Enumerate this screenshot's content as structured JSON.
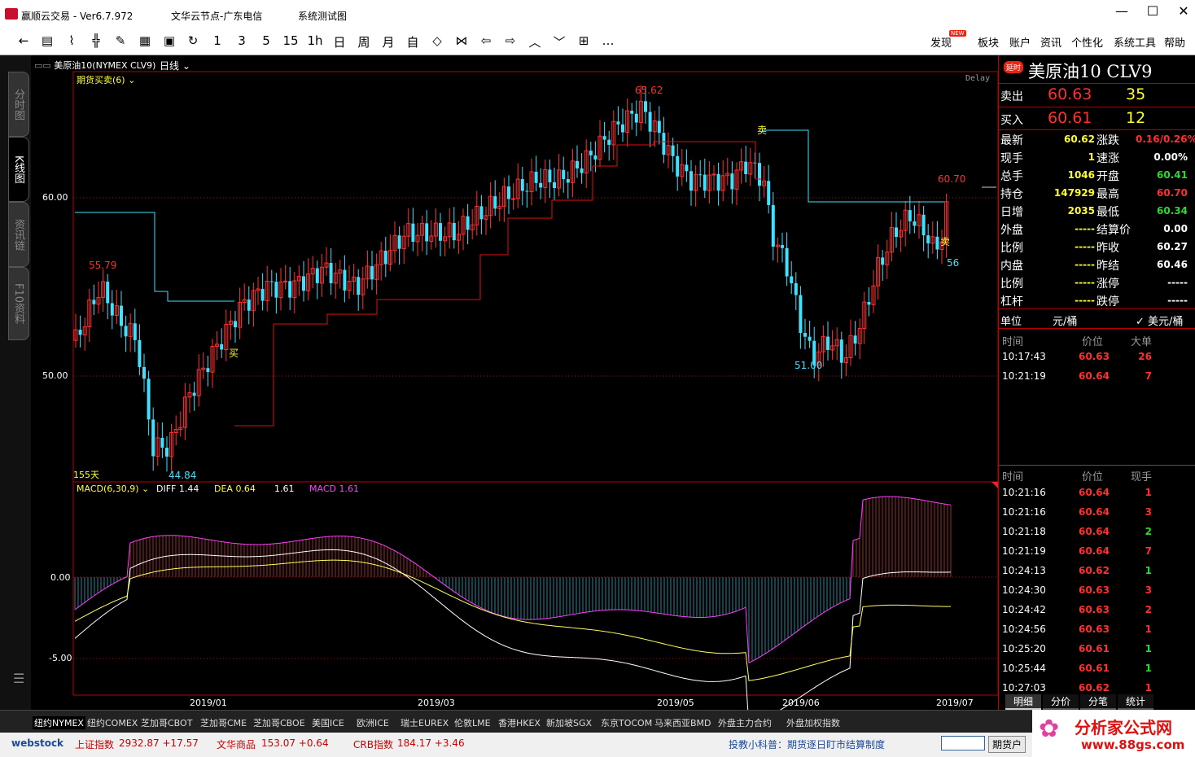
{
  "window": {
    "title": "赢顺云交易 - Ver6.7.972",
    "node": "文华云节点-广东电信",
    "test": "系统测试图"
  },
  "toolbar": {
    "periods": [
      "1",
      "3",
      "5",
      "15",
      "1h",
      "日",
      "周",
      "月",
      "自"
    ],
    "menu": [
      "发现",
      "板块",
      "账户",
      "资讯",
      "个性化",
      "系统工具",
      "帮助"
    ],
    "new_badge": "NEW"
  },
  "left_tabs": [
    "分时图",
    "K线图",
    "资讯链",
    "F10资料"
  ],
  "chart": {
    "header": "美原油10(NYMEX CLV9)",
    "period": "日线",
    "indicator": "期货买卖(6)",
    "delay": "Delay",
    "days": "155天",
    "price_labels": [
      "60.00",
      "50.00"
    ],
    "macd_labels": [
      "0.00",
      "-5.00"
    ],
    "date_labels": [
      "2019/01",
      "2019/03",
      "2019/05",
      "2019/06",
      "2019/07"
    ],
    "annotations": {
      "high": "65.62",
      "low": "44.84",
      "left_high": "55.79",
      "mid_low": "51.00",
      "right_high": "60.70",
      "right_low": "56"
    },
    "signals": {
      "buy": "买",
      "sell": "卖",
      "sell2": "卖"
    },
    "macd": {
      "name": "MACD(6,30,9)",
      "diff": "DIFF 1.44",
      "dea": "DEA 0.64",
      "val": "1.61",
      "macd": "MACD 1.61"
    }
  },
  "right": {
    "badge": "延时",
    "title": "美原油10 CLV9",
    "sell": {
      "label": "卖出",
      "price": "60.63",
      "vol": "35"
    },
    "buy": {
      "label": "买入",
      "price": "60.61",
      "vol": "12"
    },
    "quote": [
      {
        "l": "最新",
        "v": "60.62",
        "l2": "涨跌",
        "v2": "0.16/0.26%"
      },
      {
        "l": "现手",
        "v": "1",
        "l2": "速涨",
        "v2": "0.00%"
      },
      {
        "l": "总手",
        "v": "1046",
        "l2": "开盘",
        "v2": "60.41"
      },
      {
        "l": "持仓",
        "v": "147929",
        "l2": "最高",
        "v2": "60.70"
      },
      {
        "l": "日增",
        "v": "2035",
        "l2": "最低",
        "v2": "60.34"
      },
      {
        "l": "外盘",
        "v": "-----",
        "l2": "结算价",
        "v2": "0.00"
      },
      {
        "l": "比例",
        "v": "-----",
        "l2": "昨收",
        "v2": "60.27"
      },
      {
        "l": "内盘",
        "v": "-----",
        "l2": "昨结",
        "v2": "60.46"
      },
      {
        "l": "比例",
        "v": "-----",
        "l2": "涨停",
        "v2": "-----"
      },
      {
        "l": "杠杆",
        "v": "-----",
        "l2": "跌停",
        "v2": "-----"
      }
    ],
    "unit": {
      "label": "单位",
      "yuan": "元/桶",
      "usd": "✓ 美元/桶"
    },
    "big_head": [
      "时间",
      "价位",
      "大单"
    ],
    "big": [
      {
        "t": "10:17:43",
        "p": "60.63",
        "v": "26"
      },
      {
        "t": "10:21:19",
        "p": "60.64",
        "v": "7"
      }
    ],
    "tick_head": [
      "时间",
      "价位",
      "现手"
    ],
    "ticks": [
      {
        "t": "10:21:16",
        "p": "60.64",
        "v": "1",
        "c": "r"
      },
      {
        "t": "10:21:16",
        "p": "60.64",
        "v": "3",
        "c": "r"
      },
      {
        "t": "10:21:18",
        "p": "60.64",
        "v": "2",
        "c": "g"
      },
      {
        "t": "10:21:19",
        "p": "60.64",
        "v": "7",
        "c": "r"
      },
      {
        "t": "10:24:13",
        "p": "60.62",
        "v": "1",
        "c": "g"
      },
      {
        "t": "10:24:30",
        "p": "60.63",
        "v": "3",
        "c": "r"
      },
      {
        "t": "10:24:42",
        "p": "60.63",
        "v": "2",
        "c": "r"
      },
      {
        "t": "10:24:56",
        "p": "60.63",
        "v": "1",
        "c": "r"
      },
      {
        "t": "10:25:20",
        "p": "60.61",
        "v": "1",
        "c": "g"
      },
      {
        "t": "10:25:44",
        "p": "60.61",
        "v": "1",
        "c": "g"
      },
      {
        "t": "10:27:03",
        "p": "60.62",
        "v": "1",
        "c": "r"
      }
    ],
    "bottom_tabs": [
      "明细",
      "分价",
      "分笔",
      "统计"
    ]
  },
  "exchange_tabs": [
    "纽约NYMEX",
    "纽约COMEX",
    "芝加哥CBOT",
    "芝加哥CME",
    "芝加哥CBOE",
    "美国ICE",
    "欧洲ICE",
    "瑞士EUREX",
    "伦敦LME",
    "香港HKEX",
    "新加坡SGX",
    "东京TOCOM",
    "马来西亚BMD",
    "外盘主力合约",
    "外盘加权指数"
  ],
  "status": {
    "brand": "webstock",
    "sh_label": "上证指数",
    "sh_val": "2932.87 +17.57",
    "wh_label": "文华商品",
    "wh_val": "153.07 +0.64",
    "crb_label": "CRB指数",
    "crb_val": "184.17 +3.46",
    "tip": "投教小科普：期货逐日盯市结算制度",
    "btn": "期货户",
    "site": "分析家公式网",
    "url": "www.88gs.com"
  }
}
